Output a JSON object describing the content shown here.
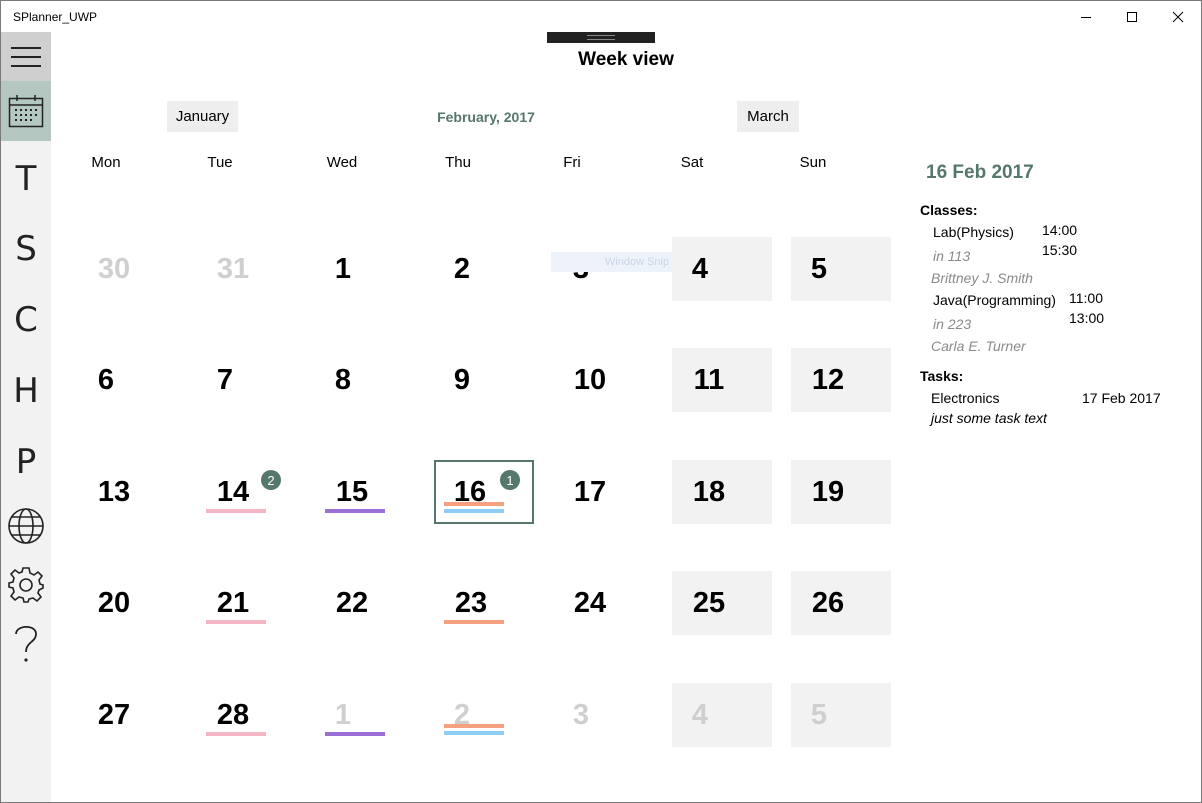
{
  "window": {
    "title": "SPlanner_UWP"
  },
  "nav": {
    "letters": [
      "T",
      "S",
      "C",
      "H",
      "P"
    ]
  },
  "header": {
    "title": "Week view",
    "prev_month": "January",
    "current_month": "February, 2017",
    "next_month": "March"
  },
  "weekdays": [
    "Mon",
    "Tue",
    "Wed",
    "Thu",
    "Fri",
    "Sat",
    "Sun"
  ],
  "weeks": [
    [
      "30",
      "31",
      "1",
      "2",
      "3",
      "4",
      "5"
    ],
    [
      "6",
      "7",
      "8",
      "9",
      "10",
      "11",
      "12"
    ],
    [
      "13",
      "14",
      "15",
      "16",
      "17",
      "18",
      "19"
    ],
    [
      "20",
      "21",
      "22",
      "23",
      "24",
      "25",
      "26"
    ],
    [
      "27",
      "28",
      "1",
      "2",
      "3",
      "4",
      "5"
    ]
  ],
  "badges": {
    "feb14": "2",
    "feb16": "1"
  },
  "overlay": {
    "snip_text": "Window Snip"
  },
  "colors": {
    "accent": "#55776d",
    "pink": "#f4b6c4",
    "purple": "#9a6fd6",
    "orange": "#f5a07e",
    "blue": "#90cdf4"
  },
  "detail": {
    "date": "16 Feb 2017",
    "classes_label": "Classes:",
    "classes": [
      {
        "name": "Lab(Physics)",
        "start": "14:00",
        "end": "15:30",
        "room": "in 113",
        "teacher": "Brittney J. Smith"
      },
      {
        "name": "Java(Programming)",
        "start": "11:00",
        "end": "13:00",
        "room": "in 223",
        "teacher": "Carla E. Turner"
      }
    ],
    "tasks_label": "Tasks:",
    "tasks": [
      {
        "name": "Electronics",
        "date": "17 Feb 2017",
        "text": "just some task text"
      }
    ]
  }
}
